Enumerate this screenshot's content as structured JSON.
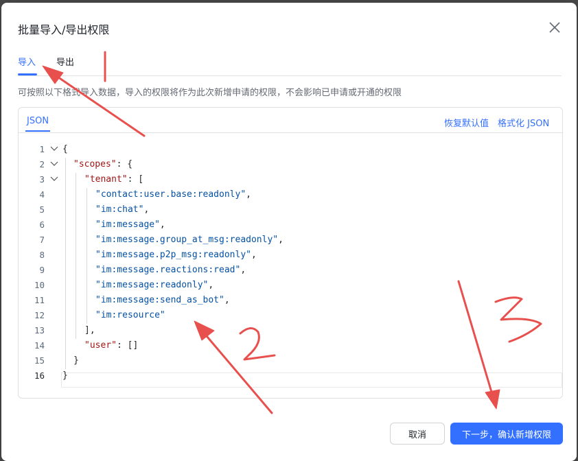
{
  "dialog": {
    "title": "批量导入/导出权限",
    "tabs": [
      {
        "label": "导入",
        "active": true
      },
      {
        "label": "导出",
        "active": false
      }
    ],
    "description": "可按照以下格式导入数据，导入的权限将作为此次新增申请的权限，不会影响已申请或开通的权限"
  },
  "editor": {
    "tab_label": "JSON",
    "restore_label": "恢复默认值",
    "format_label": "格式化 JSON",
    "line_numbers": [
      "1",
      "2",
      "3",
      "4",
      "5",
      "6",
      "7",
      "8",
      "9",
      "10",
      "11",
      "12",
      "13",
      "14",
      "15",
      "16"
    ],
    "scope_values": [
      "\"contact:user.base:readonly\"",
      "\"im:chat\"",
      "\"im:message\"",
      "\"im:message.group_at_msg:readonly\"",
      "\"im:message.p2p_msg:readonly\"",
      "\"im:message.reactions:read\"",
      "\"im:message:readonly\"",
      "\"im:message:send_as_bot\"",
      "\"im:resource\""
    ]
  },
  "footer": {
    "cancel_label": "取消",
    "next_label": "下一步，确认新增权限"
  },
  "colors": {
    "accent": "#3370ff",
    "annotation": "#e8504d"
  }
}
